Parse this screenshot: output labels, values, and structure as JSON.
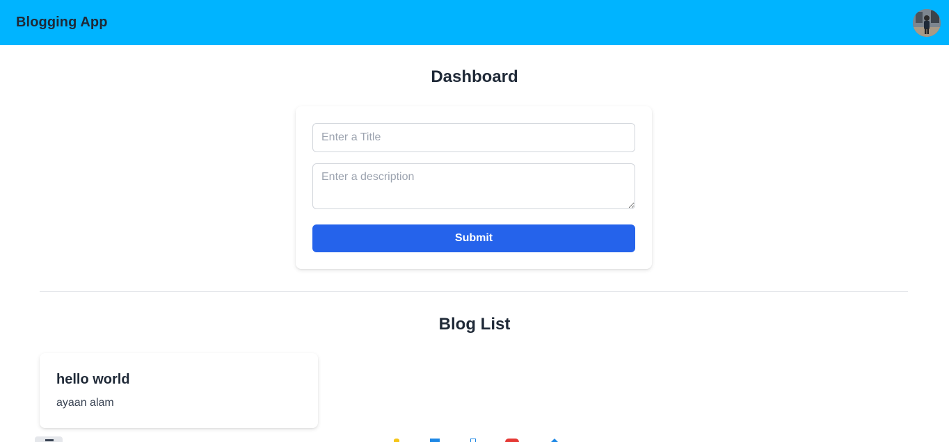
{
  "navbar": {
    "brand": "Blogging App"
  },
  "dashboard": {
    "title": "Dashboard",
    "form": {
      "title_placeholder": "Enter a Title",
      "title_value": "",
      "description_placeholder": "Enter a description",
      "description_value": "",
      "submit_label": "Submit"
    }
  },
  "blog_list": {
    "title": "Blog List",
    "posts": [
      {
        "title": "hello world",
        "description": "ayaan alam"
      }
    ]
  },
  "colors": {
    "navbar": "#00b4ff",
    "submit_button": "#2563eb",
    "text": "#1f2937"
  },
  "icons": {
    "avatar": "user-avatar",
    "dock": [
      "yellow-icon",
      "blue-icon",
      "blue-outline-icon",
      "red-icon",
      "blue-arrow-icon"
    ]
  }
}
